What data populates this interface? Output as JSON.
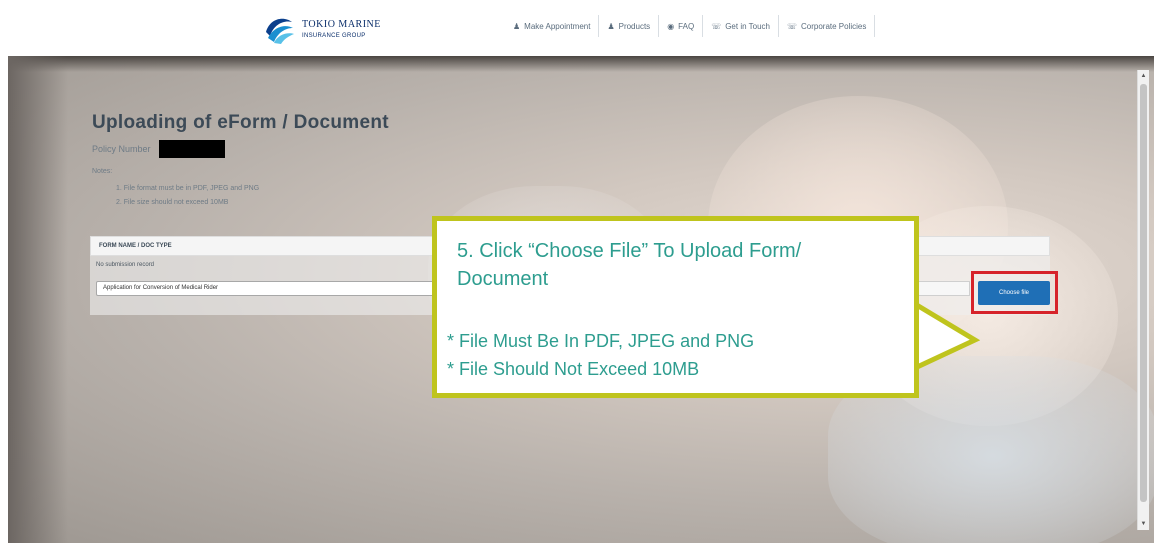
{
  "brand": {
    "name_line1": "TOKIO MARINE",
    "name_line2": "INSURANCE GROUP"
  },
  "nav": {
    "items": [
      {
        "label": "Make Appointment",
        "icon": "user-icon"
      },
      {
        "label": "Products",
        "icon": "user-icon"
      },
      {
        "label": "FAQ",
        "icon": "eye-icon"
      },
      {
        "label": "Get in Touch",
        "icon": "phone-icon"
      },
      {
        "label": "Corporate Policies",
        "icon": "phone-icon"
      }
    ]
  },
  "page": {
    "title": "Uploading of eForm / Document",
    "policy_label": "Policy Number",
    "notes_title": "Notes:",
    "notes": [
      "1. File format must be in PDF, JPEG and PNG",
      "2. File size should not exceed 10MB"
    ]
  },
  "table": {
    "header": "FORM NAME / DOC TYPE",
    "subtitle": "No submission record",
    "selected_form": "Application for Conversion of Medical Rider",
    "choose_label": "Choose file"
  },
  "callout": {
    "step": "5. Click “Choose File” To Upload Form/ Document",
    "req1": "* File Must Be In PDF, JPEG and PNG",
    "req2": "* File Should Not Exceed 10MB",
    "border_color": "#bfc41d",
    "text_color": "#2d9d8f"
  },
  "colors": {
    "accent_button": "#1f6fb6",
    "highlight": "#d6232a"
  }
}
